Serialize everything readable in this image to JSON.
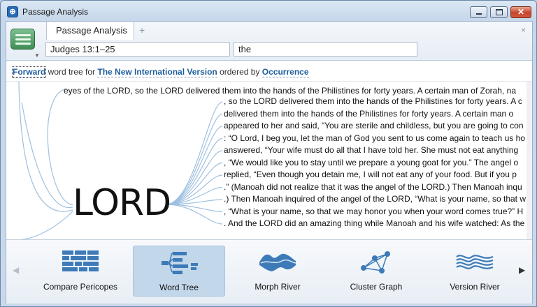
{
  "window": {
    "title": "Passage Analysis"
  },
  "tab": {
    "label": "Passage Analysis",
    "add": "+",
    "close": "×"
  },
  "inputs": {
    "reference": "Judges 13:1–25",
    "search": "the"
  },
  "description": {
    "direction": "Forward",
    "text1": " word tree for ",
    "version": "The New International Version",
    "text2": " ordered by ",
    "order": "Occurrence"
  },
  "word_tree": {
    "root": "LORD",
    "left_context": "eyes of the LORD, so the LORD delivered them into the hands of the Philistines for forty years.  A certain man of Zorah, na",
    "branches": [
      ", so the LORD delivered them into the hands of the Philistines for forty years.  A c",
      "delivered them into the hands of the Philistines for forty years.  A certain man o",
      "appeared to her and said, “You are sterile and childless, but you are going to con",
      ": “O Lord, I beg you, let the man of God you sent to us come again to teach us ho",
      "answered, “Your wife must do all that I have told her. She must not eat anything",
      ", “We would like you to stay until we prepare a young goat for you.”  The angel o",
      "replied, “Even though you detain me, I will not eat any of your food. But if you p",
      ".” (Manoah did not realize that it was the angel of the LORD.)  Then Manoah inqu",
      ".)  Then Manoah inquired of the angel of the LORD, “What is your name, so that w",
      ", “What is your name, so that we may honor you when your word comes true?”  H",
      ". And the LORD did an amazing thing while Manoah and his wife watched: As the"
    ]
  },
  "tools": [
    {
      "label": "Compare Pericopes",
      "icon": "compare-pericopes-icon",
      "selected": false
    },
    {
      "label": "Word Tree",
      "icon": "word-tree-icon",
      "selected": true
    },
    {
      "label": "Morph River",
      "icon": "morph-river-icon",
      "selected": false
    },
    {
      "label": "Cluster Graph",
      "icon": "cluster-graph-icon",
      "selected": false
    },
    {
      "label": "Version River",
      "icon": "version-river-icon",
      "selected": false
    }
  ],
  "colors": {
    "branch_line": "#9fc0e0",
    "icon_blue": "#3d7bb8",
    "selected_tool": "#c3d7ea"
  }
}
